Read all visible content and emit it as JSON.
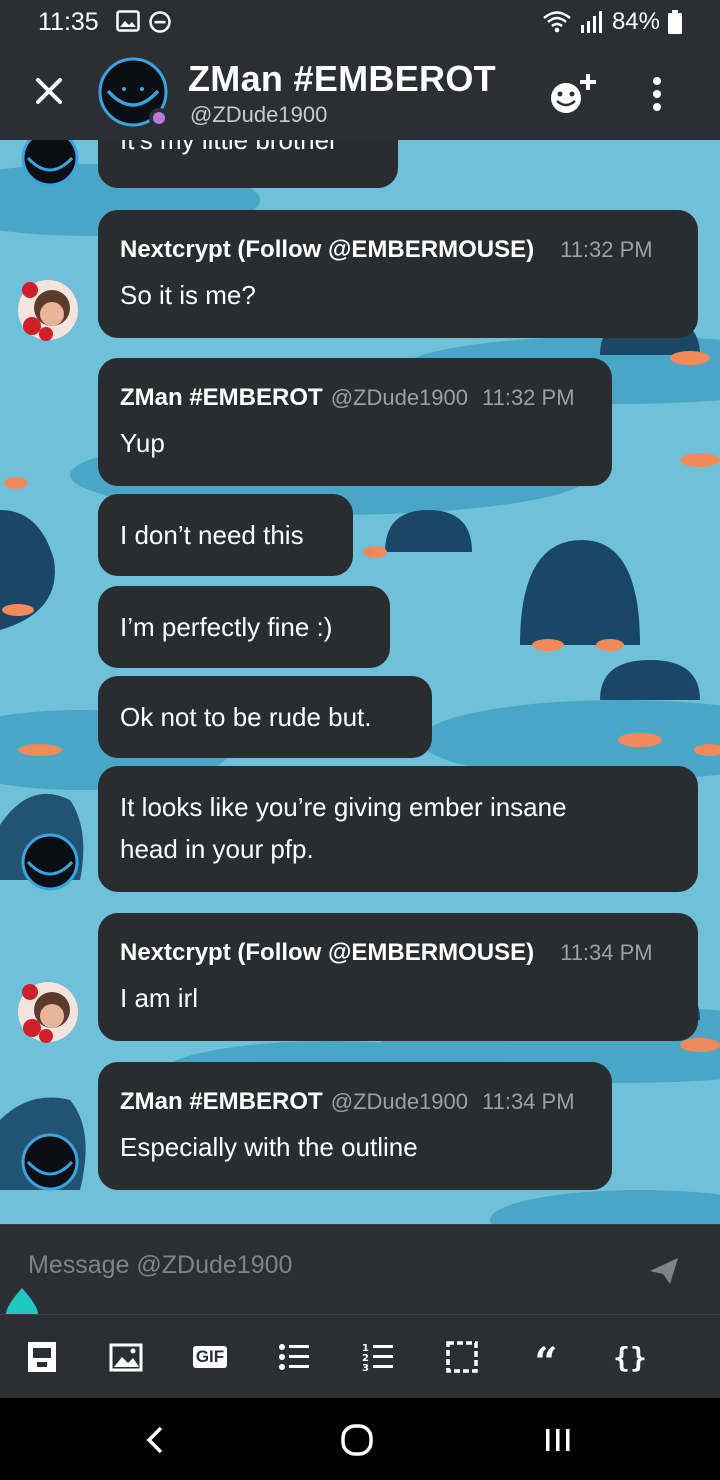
{
  "status_bar": {
    "time": "11:35",
    "battery": "84%",
    "icons": [
      "image-icon",
      "do-not-disturb-icon",
      "wifi-icon",
      "signal-icon",
      "battery-icon"
    ]
  },
  "header": {
    "title": "ZMan #EMBEROT",
    "handle": "@ZDude1900",
    "icons": [
      "close-icon",
      "avatar",
      "add-user-icon",
      "more-vert-icon"
    ]
  },
  "colors": {
    "bar_bg": "#2b2f33",
    "bubble_bg": "#2a2d30",
    "chat_bg": "#6fc1d9",
    "presence": "#b87ad8",
    "accent": "#1ec8c0"
  },
  "messages": [
    {
      "body": "It’s my little brother"
    },
    {
      "author": "Nextcrypt (Follow @EMBERMOUSE)",
      "time": "11:32 PM",
      "body": "So it is me?"
    },
    {
      "author": "ZMan #EMBEROT",
      "handle": "@ZDude1900",
      "time": "11:32 PM",
      "body": "Yup"
    },
    {
      "body": "I don’t need this"
    },
    {
      "body": "I’m perfectly fine :)"
    },
    {
      "body": "Ok not to be rude but."
    },
    {
      "body_line1": "It looks like you’re giving ember insane",
      "body_line2": "head in your pfp."
    },
    {
      "author": "Nextcrypt (Follow @EMBERMOUSE)",
      "time": "11:34 PM",
      "body": "I am irl"
    },
    {
      "author": "ZMan #EMBEROT",
      "handle": "@ZDude1900",
      "time": "11:34 PM",
      "body": "Especially with the outline"
    }
  ],
  "composer": {
    "placeholder": "Message @ZDude1900"
  },
  "toolbar": {
    "gif_label": "GIF",
    "quote_label": "“",
    "code_label": "{}",
    "icons": [
      "spoiler-icon",
      "image-icon",
      "gif-icon",
      "bulleted-list-icon",
      "numbered-list-icon",
      "select-icon",
      "quote-icon",
      "code-block-icon"
    ]
  },
  "nav": {
    "icons": [
      "back-icon",
      "home-icon",
      "recents-icon"
    ]
  }
}
